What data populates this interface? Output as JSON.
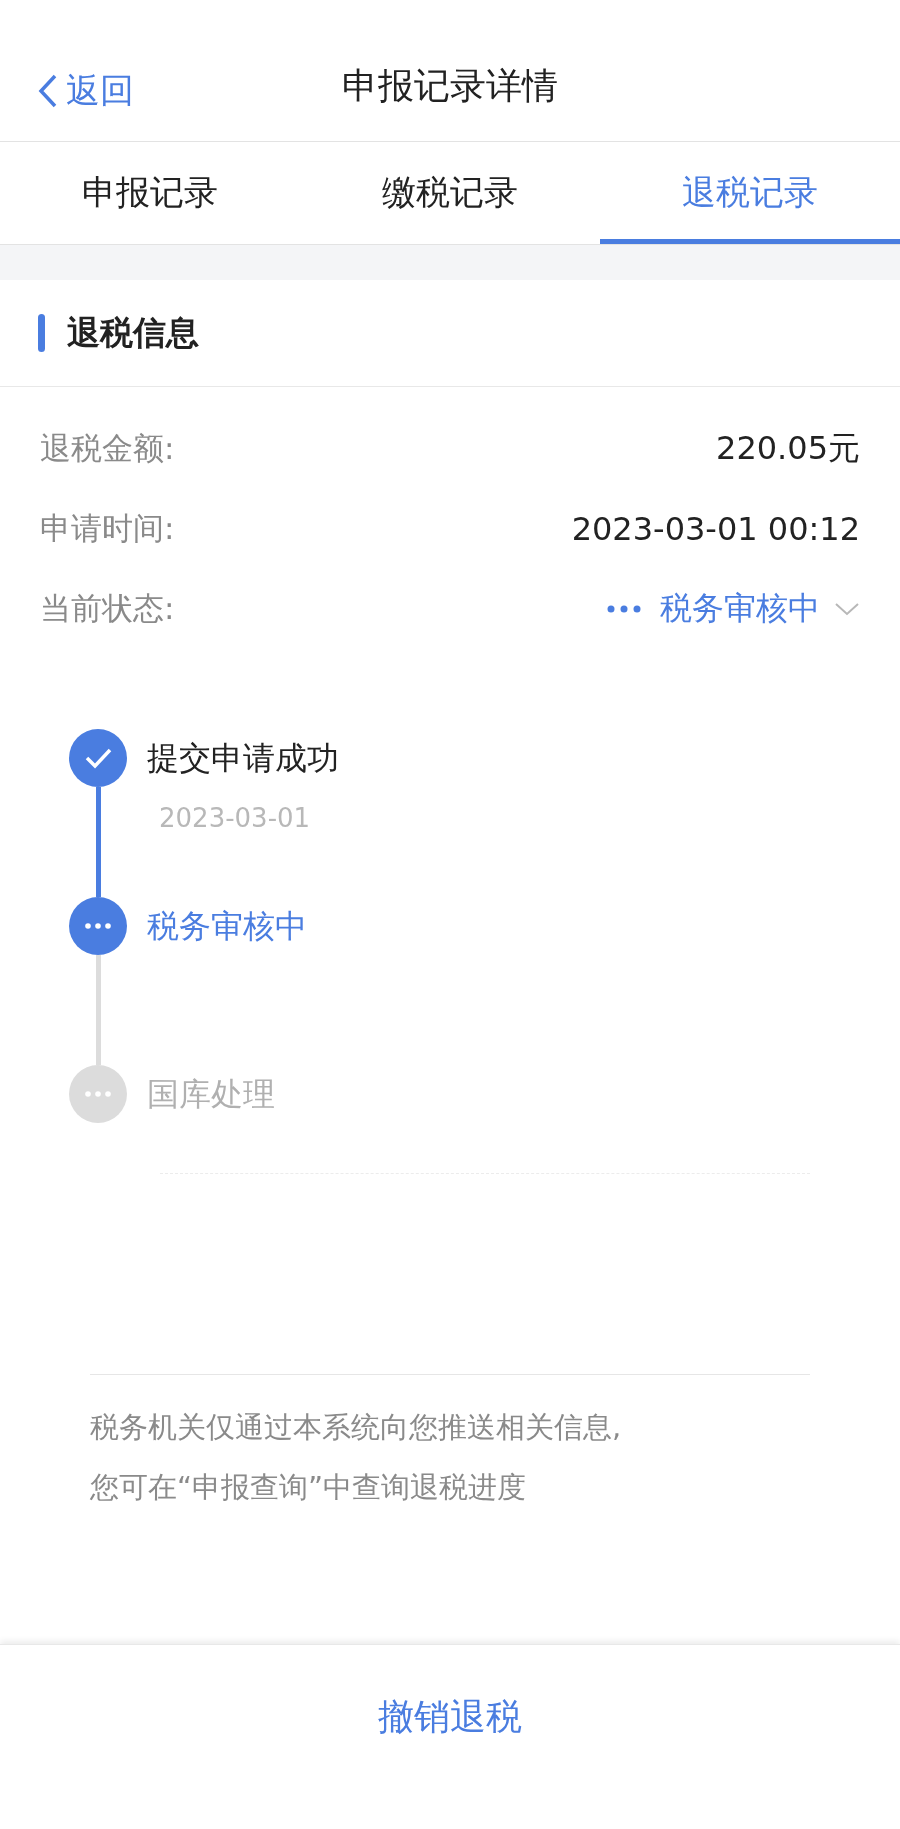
{
  "header": {
    "back": "返回",
    "title": "申报记录详情"
  },
  "tabs": [
    {
      "label": "申报记录",
      "selected": false
    },
    {
      "label": "缴税记录",
      "selected": false
    },
    {
      "label": "退税记录",
      "selected": true
    }
  ],
  "section": {
    "title": "退税信息"
  },
  "fields": [
    {
      "label": "退税金额:",
      "value": "220.05元",
      "kind": "plain"
    },
    {
      "label": "申请时间:",
      "value": "2023-03-01 00:12",
      "kind": "plain"
    },
    {
      "label": "当前状态:",
      "value": "税务审核中",
      "kind": "status"
    }
  ],
  "steps": [
    {
      "title": "提交申请成功",
      "date": "2023-03-01",
      "kind": "done"
    },
    {
      "title": "税务审核中",
      "kind": "active"
    },
    {
      "title": "国库处理",
      "kind": "pending"
    }
  ],
  "note": [
    "税务机关仅通过本系统向您推送相关信息,",
    "您可在“申报查询”中查询退税进度"
  ],
  "action": "撤销退税"
}
